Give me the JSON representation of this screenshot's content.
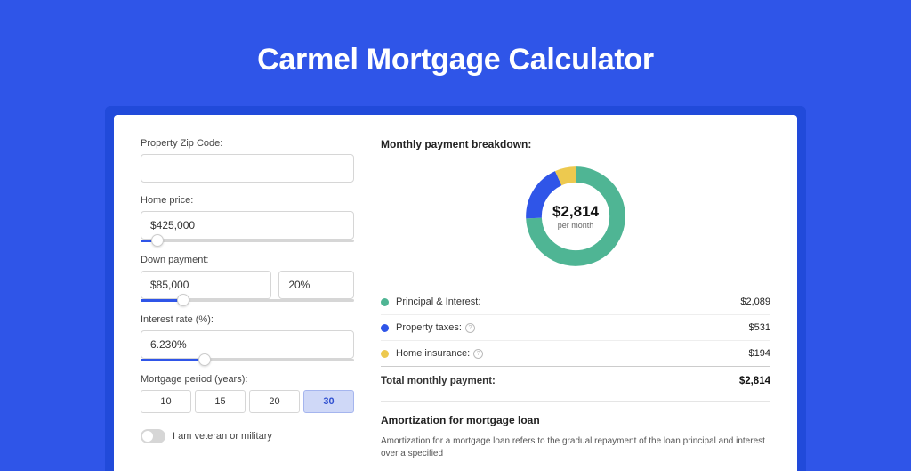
{
  "page_title": "Carmel Mortgage Calculator",
  "form": {
    "zip": {
      "label": "Property Zip Code:",
      "value": ""
    },
    "price": {
      "label": "Home price:",
      "value": "$425,000",
      "slider_percent": 8
    },
    "down": {
      "label": "Down payment:",
      "amount": "$85,000",
      "percent": "20%",
      "slider_percent": 20
    },
    "rate": {
      "label": "Interest rate (%):",
      "value": "6.230%",
      "slider_percent": 30
    },
    "period": {
      "label": "Mortgage period (years):",
      "options": [
        "10",
        "15",
        "20",
        "30"
      ],
      "selected": "30"
    },
    "veteran": {
      "label": "I am veteran or military",
      "on": false
    }
  },
  "breakdown": {
    "title": "Monthly payment breakdown:",
    "center_value": "$2,814",
    "center_sub": "per month",
    "items": [
      {
        "label": "Principal & Interest:",
        "value": "$2,089",
        "color": "green",
        "info": false
      },
      {
        "label": "Property taxes:",
        "value": "$531",
        "color": "blue",
        "info": true
      },
      {
        "label": "Home insurance:",
        "value": "$194",
        "color": "yellow",
        "info": true
      }
    ],
    "total_label": "Total monthly payment:",
    "total_value": "$2,814"
  },
  "amortization": {
    "title": "Amortization for mortgage loan",
    "text": "Amortization for a mortgage loan refers to the gradual repayment of the loan principal and interest over a specified"
  },
  "chart_data": {
    "type": "pie",
    "title": "Monthly payment breakdown",
    "series": [
      {
        "name": "Principal & Interest",
        "value": 2089,
        "color": "#4fb594"
      },
      {
        "name": "Property taxes",
        "value": 531,
        "color": "#2f55e8"
      },
      {
        "name": "Home insurance",
        "value": 194,
        "color": "#edc94f"
      }
    ],
    "total": 2814,
    "center_label": "$2,814 per month"
  }
}
